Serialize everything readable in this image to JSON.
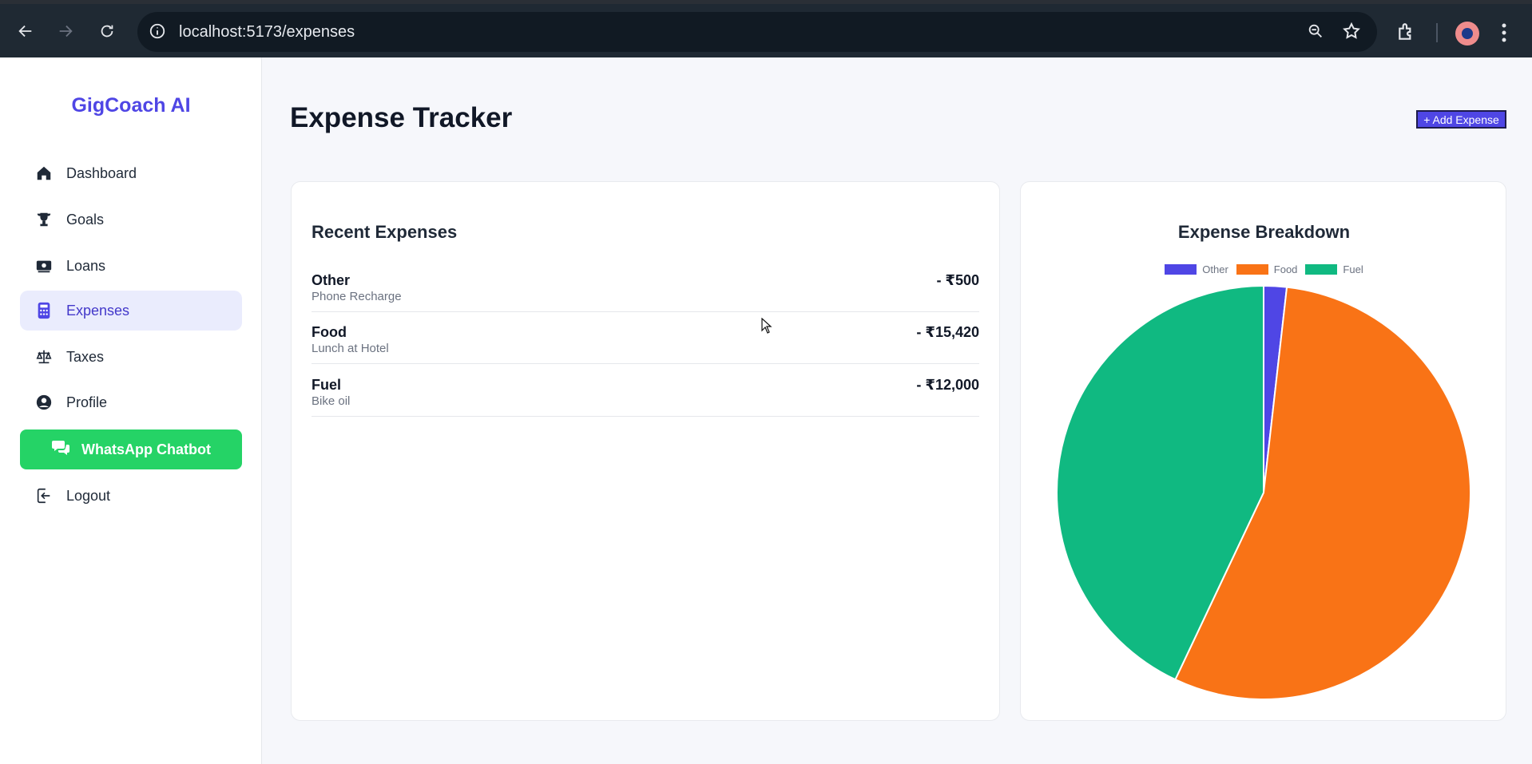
{
  "browser": {
    "url": "localhost:5173/expenses"
  },
  "sidebar": {
    "brand": "GigCoach AI",
    "items": [
      {
        "label": "Dashboard",
        "icon": "home-icon"
      },
      {
        "label": "Goals",
        "icon": "trophy-icon"
      },
      {
        "label": "Loans",
        "icon": "money-icon"
      },
      {
        "label": "Expenses",
        "icon": "calculator-icon",
        "active": true
      },
      {
        "label": "Taxes",
        "icon": "scale-icon"
      },
      {
        "label": "Profile",
        "icon": "user-circle-icon"
      }
    ],
    "whatsapp_label": "WhatsApp Chatbot",
    "logout_label": "Logout"
  },
  "main": {
    "title": "Expense Tracker",
    "add_button": "+ Add Expense",
    "recent": {
      "title": "Recent Expenses",
      "rows": [
        {
          "category": "Other",
          "description": "Phone Recharge",
          "amount": "- ₹500"
        },
        {
          "category": "Food",
          "description": "Lunch at Hotel",
          "amount": "- ₹15,420"
        },
        {
          "category": "Fuel",
          "description": "Bike oil",
          "amount": "- ₹12,000"
        }
      ]
    },
    "breakdown": {
      "title": "Expense Breakdown"
    }
  },
  "chart_data": {
    "type": "pie",
    "title": "Expense Breakdown",
    "categories": [
      "Other",
      "Food",
      "Fuel"
    ],
    "values": [
      500,
      15420,
      12000
    ],
    "colors": [
      "#4f46e5",
      "#f97316",
      "#10b981"
    ],
    "legend": "top"
  },
  "colors": {
    "accent": "#4f46e5",
    "whatsapp": "#25d366"
  }
}
